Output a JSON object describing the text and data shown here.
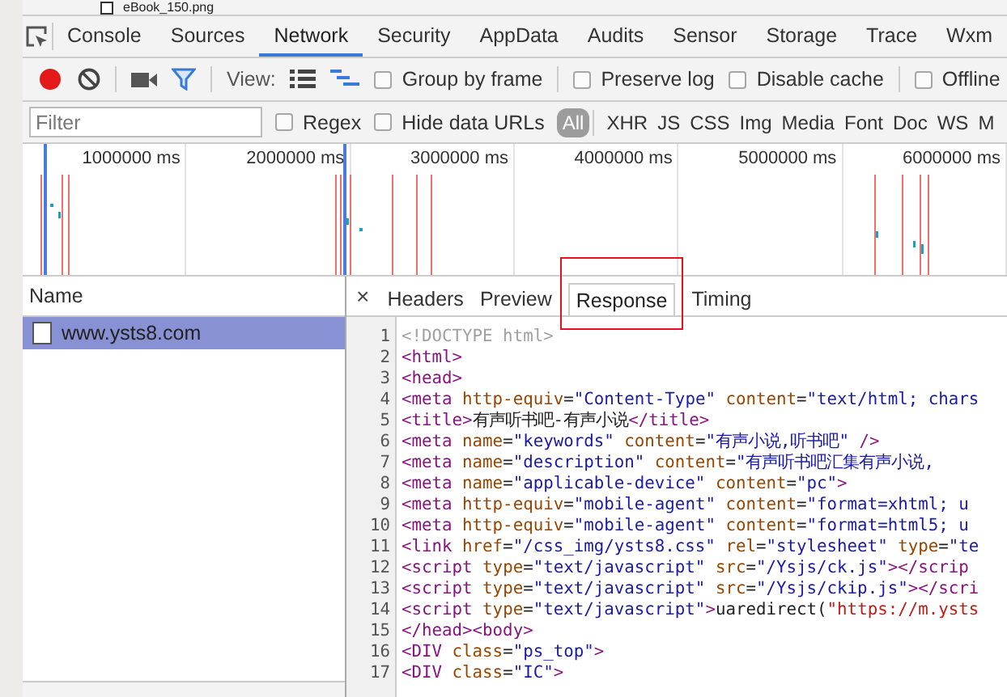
{
  "page_strip": {
    "file_name": "eBook_150.png"
  },
  "tabs": [
    {
      "label": "Console",
      "selected": false
    },
    {
      "label": "Sources",
      "selected": false
    },
    {
      "label": "Network",
      "selected": true
    },
    {
      "label": "Security",
      "selected": false
    },
    {
      "label": "AppData",
      "selected": false
    },
    {
      "label": "Audits",
      "selected": false
    },
    {
      "label": "Sensor",
      "selected": false
    },
    {
      "label": "Storage",
      "selected": false
    },
    {
      "label": "Trace",
      "selected": false
    },
    {
      "label": "Wxm",
      "selected": false
    }
  ],
  "toolbar": {
    "recording": true,
    "filter_on": true,
    "view_label": "View:",
    "view_modes": [
      {
        "kind": "list",
        "selected": false
      },
      {
        "kind": "waterfall",
        "selected": true
      }
    ],
    "options": [
      {
        "label": "Group by frame",
        "checked": false
      },
      {
        "label": "Preserve log",
        "checked": false
      },
      {
        "label": "Disable cache",
        "checked": false
      },
      {
        "label": "Offline",
        "checked": false
      }
    ]
  },
  "filter_bar": {
    "placeholder": "Filter",
    "options": [
      {
        "label": "Regex",
        "checked": false
      },
      {
        "label": "Hide data URLs",
        "checked": false
      }
    ],
    "types": [
      {
        "label": "All",
        "selected": true
      },
      {
        "label": "XHR",
        "selected": false
      },
      {
        "label": "JS",
        "selected": false
      },
      {
        "label": "CSS",
        "selected": false
      },
      {
        "label": "Img",
        "selected": false
      },
      {
        "label": "Media",
        "selected": false
      },
      {
        "label": "Font",
        "selected": false
      },
      {
        "label": "Doc",
        "selected": false
      },
      {
        "label": "WS",
        "selected": false
      },
      {
        "label": "M",
        "selected": false
      }
    ]
  },
  "overview": {
    "ticks": [
      "1000000 ms",
      "2000000 ms",
      "3000000 ms",
      "4000000 ms",
      "5000000 ms",
      "6000000 ms"
    ]
  },
  "requests": {
    "header": "Name",
    "rows": [
      {
        "name": "www.ysts8.com",
        "selected": true
      }
    ]
  },
  "detail": {
    "close": "×",
    "tabs": [
      {
        "label": "Headers",
        "selected": false,
        "highlighted": false
      },
      {
        "label": "Preview",
        "selected": false,
        "highlighted": false
      },
      {
        "label": "Response",
        "selected": true,
        "highlighted": true
      },
      {
        "label": "Timing",
        "selected": false,
        "highlighted": false
      }
    ],
    "lines": [
      {
        "number": "1",
        "tokens": [
          {
            "kind": "doc",
            "text": "<!DOCTYPE html>"
          }
        ]
      },
      {
        "number": "2",
        "tokens": [
          {
            "kind": "tag",
            "text": "<html>"
          }
        ]
      },
      {
        "number": "3",
        "tokens": [
          {
            "kind": "tag",
            "text": "<head>"
          }
        ]
      },
      {
        "number": "4",
        "tokens": [
          {
            "kind": "tag",
            "text": "<meta"
          },
          {
            "kind": "attr",
            "text": " http-equiv"
          },
          {
            "kind": "text",
            "text": "="
          },
          {
            "kind": "val",
            "text": "\"Content-Type\""
          },
          {
            "kind": "attr",
            "text": " content"
          },
          {
            "kind": "text",
            "text": "="
          },
          {
            "kind": "val",
            "text": "\"text/html; chars"
          }
        ]
      },
      {
        "number": "5",
        "tokens": [
          {
            "kind": "tag",
            "text": "<title>"
          },
          {
            "kind": "text",
            "text": "有声听书吧-有声小说"
          },
          {
            "kind": "tag",
            "text": "</title>"
          }
        ]
      },
      {
        "number": "6",
        "tokens": [
          {
            "kind": "tag",
            "text": "<meta"
          },
          {
            "kind": "attr",
            "text": " name"
          },
          {
            "kind": "text",
            "text": "="
          },
          {
            "kind": "val",
            "text": "\"keywords\""
          },
          {
            "kind": "attr",
            "text": " content"
          },
          {
            "kind": "text",
            "text": "="
          },
          {
            "kind": "val",
            "text": "\"有声小说,听书吧\""
          },
          {
            "kind": "tag",
            "text": " />"
          }
        ]
      },
      {
        "number": "7",
        "tokens": [
          {
            "kind": "tag",
            "text": "<meta"
          },
          {
            "kind": "attr",
            "text": " name"
          },
          {
            "kind": "text",
            "text": "="
          },
          {
            "kind": "val",
            "text": "\"description\""
          },
          {
            "kind": "attr",
            "text": " content"
          },
          {
            "kind": "text",
            "text": "="
          },
          {
            "kind": "val",
            "text": "\"有声听书吧汇集有声小说,"
          }
        ]
      },
      {
        "number": "8",
        "tokens": [
          {
            "kind": "tag",
            "text": "<meta"
          },
          {
            "kind": "attr",
            "text": " name"
          },
          {
            "kind": "text",
            "text": "="
          },
          {
            "kind": "val",
            "text": "\"applicable-device\""
          },
          {
            "kind": "attr",
            "text": " content"
          },
          {
            "kind": "text",
            "text": "="
          },
          {
            "kind": "val",
            "text": "\"pc\""
          },
          {
            "kind": "tag",
            "text": ">"
          }
        ]
      },
      {
        "number": "9",
        "tokens": [
          {
            "kind": "tag",
            "text": "<meta"
          },
          {
            "kind": "attr",
            "text": " http-equiv"
          },
          {
            "kind": "text",
            "text": "="
          },
          {
            "kind": "val",
            "text": "\"mobile-agent\""
          },
          {
            "kind": "attr",
            "text": " content"
          },
          {
            "kind": "text",
            "text": "="
          },
          {
            "kind": "val",
            "text": "\"format=xhtml; u"
          }
        ]
      },
      {
        "number": "10",
        "tokens": [
          {
            "kind": "tag",
            "text": "<meta"
          },
          {
            "kind": "attr",
            "text": " http-equiv"
          },
          {
            "kind": "text",
            "text": "="
          },
          {
            "kind": "val",
            "text": "\"mobile-agent\""
          },
          {
            "kind": "attr",
            "text": " content"
          },
          {
            "kind": "text",
            "text": "="
          },
          {
            "kind": "val",
            "text": "\"format=html5; u"
          }
        ]
      },
      {
        "number": "11",
        "tokens": [
          {
            "kind": "tag",
            "text": "<link"
          },
          {
            "kind": "attr",
            "text": " href"
          },
          {
            "kind": "text",
            "text": "="
          },
          {
            "kind": "val",
            "text": "\"/css_img/ysts8.css\""
          },
          {
            "kind": "attr",
            "text": " rel"
          },
          {
            "kind": "text",
            "text": "="
          },
          {
            "kind": "val",
            "text": "\"stylesheet\""
          },
          {
            "kind": "attr",
            "text": " type"
          },
          {
            "kind": "text",
            "text": "="
          },
          {
            "kind": "val",
            "text": "\"te"
          }
        ]
      },
      {
        "number": "12",
        "tokens": [
          {
            "kind": "tag",
            "text": "<script"
          },
          {
            "kind": "attr",
            "text": " type"
          },
          {
            "kind": "text",
            "text": "="
          },
          {
            "kind": "val",
            "text": "\"text/javascript\""
          },
          {
            "kind": "attr",
            "text": " src"
          },
          {
            "kind": "text",
            "text": "="
          },
          {
            "kind": "val",
            "text": "\"/Ysjs/ck.js\""
          },
          {
            "kind": "tag",
            "text": "></scrip"
          }
        ]
      },
      {
        "number": "13",
        "tokens": [
          {
            "kind": "tag",
            "text": "<script"
          },
          {
            "kind": "attr",
            "text": " type"
          },
          {
            "kind": "text",
            "text": "="
          },
          {
            "kind": "val",
            "text": "\"text/javascript\""
          },
          {
            "kind": "attr",
            "text": " src"
          },
          {
            "kind": "text",
            "text": "="
          },
          {
            "kind": "val",
            "text": "\"/Ysjs/ckip.js\""
          },
          {
            "kind": "tag",
            "text": "></scri"
          }
        ]
      },
      {
        "number": "14",
        "tokens": [
          {
            "kind": "tag",
            "text": "<script"
          },
          {
            "kind": "attr",
            "text": " type"
          },
          {
            "kind": "text",
            "text": "="
          },
          {
            "kind": "val",
            "text": "\"text/javascript\""
          },
          {
            "kind": "tag",
            "text": ">"
          },
          {
            "kind": "text",
            "text": "uaredirect("
          },
          {
            "kind": "str",
            "text": "\"https://m.ysts"
          }
        ]
      },
      {
        "number": "15",
        "tokens": [
          {
            "kind": "tag",
            "text": "</head><body>"
          }
        ]
      },
      {
        "number": "16",
        "tokens": [
          {
            "kind": "tag",
            "text": "<DIV"
          },
          {
            "kind": "attr",
            "text": " class"
          },
          {
            "kind": "text",
            "text": "="
          },
          {
            "kind": "val",
            "text": "\"ps_top\""
          },
          {
            "kind": "tag",
            "text": ">"
          }
        ]
      },
      {
        "number": "17",
        "tokens": [
          {
            "kind": "tag",
            "text": "<DIV"
          },
          {
            "kind": "attr",
            "text": " class"
          },
          {
            "kind": "text",
            "text": "="
          },
          {
            "kind": "val",
            "text": "\"IC\""
          },
          {
            "kind": "tag",
            "text": ">"
          }
        ]
      }
    ]
  }
}
